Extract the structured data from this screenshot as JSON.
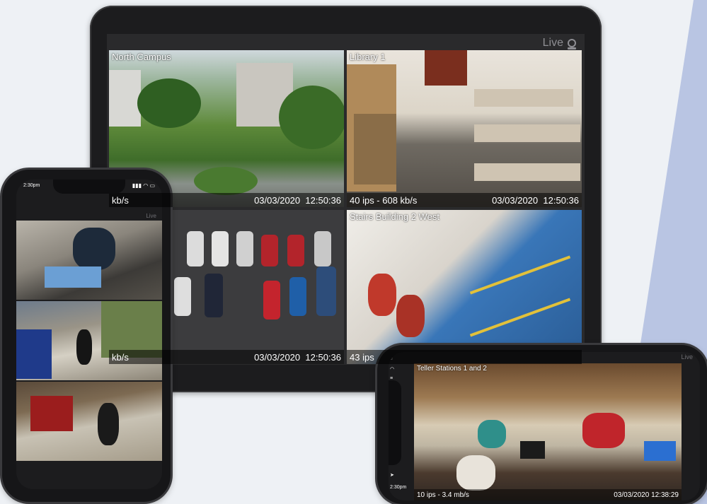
{
  "tablet": {
    "header_label": "Live",
    "feeds": [
      {
        "title": "North Campus",
        "footer_left": "kb/s",
        "date": "03/03/2020",
        "time": "12:50:36"
      },
      {
        "title": "Library 1",
        "footer_left": "40 ips - 608 kb/s",
        "date": "03/03/2020",
        "time": "12:50:36"
      },
      {
        "title": "",
        "footer_left": "kb/s",
        "date": "03/03/2020",
        "time": "12:50:36"
      },
      {
        "title": "Stairs Building 2 West",
        "footer_left": "43 ips",
        "date": "",
        "time": ""
      }
    ]
  },
  "phone_portrait": {
    "status_time": "2:30pm",
    "header_label": "Live"
  },
  "phone_landscape": {
    "header_label": "Live",
    "status_time": "2:30pm",
    "feed": {
      "title": "Teller Stations 1 and 2",
      "footer_left": "10 ips - 3.4 mb/s",
      "date": "03/03/2020",
      "time": "12:38:29"
    }
  },
  "icons": {
    "camera": "camera-icon",
    "location": "location-arrow-icon",
    "signal": "signal-icon",
    "wifi": "wifi-icon",
    "battery": "battery-icon"
  }
}
